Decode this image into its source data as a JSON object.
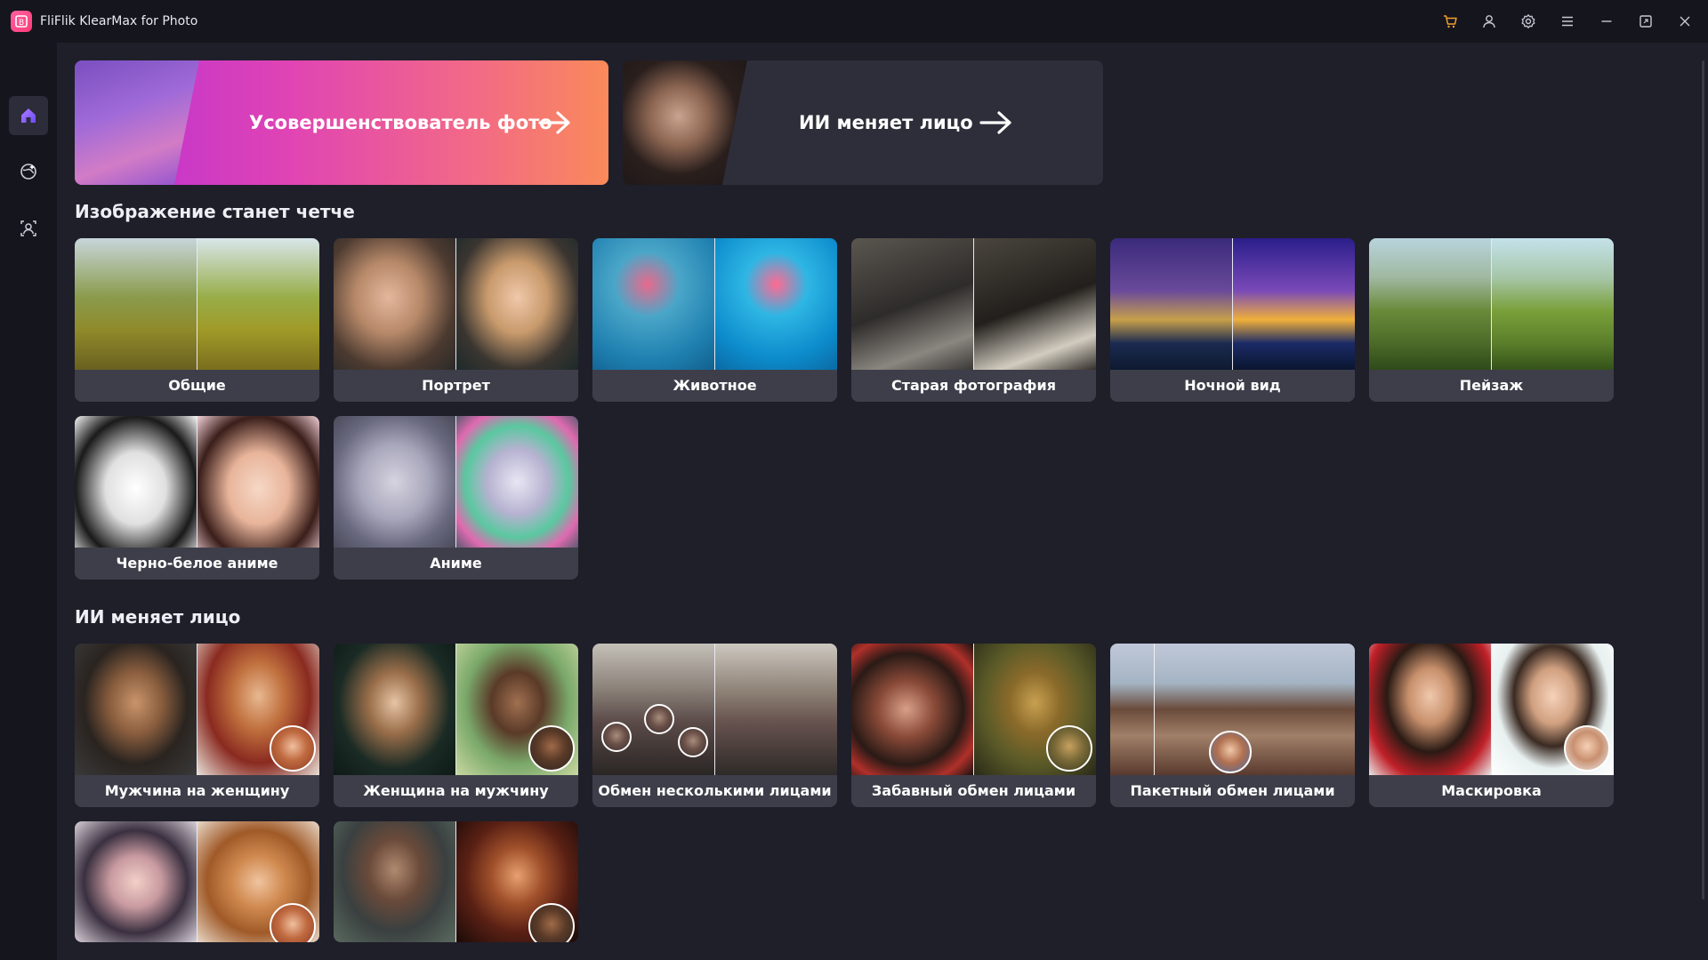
{
  "window": {
    "title": "FliFlik KlearMax for Photo",
    "logo_text": "B",
    "accent": "#ff4f8a",
    "cart_color": "#f0a030"
  },
  "titlebar_icons": [
    "cart-icon",
    "account-icon",
    "settings-icon",
    "menu-icon",
    "minimize-icon",
    "maximize-icon",
    "close-icon"
  ],
  "sidebar": {
    "items": [
      {
        "name": "home",
        "icon": "home-icon",
        "active": true
      },
      {
        "name": "enhancer",
        "icon": "globe-enhance-icon",
        "active": false
      },
      {
        "name": "face-swap",
        "icon": "face-swap-icon",
        "active": false
      }
    ]
  },
  "banners": {
    "enhancer": {
      "label": "Усовершенствователь фото"
    },
    "faceswap": {
      "label": "ИИ меняет лицо"
    }
  },
  "sections": {
    "enhance": {
      "title": "Изображение станет четче",
      "cards": [
        {
          "label": "Общие"
        },
        {
          "label": "Портрет"
        },
        {
          "label": "Животное"
        },
        {
          "label": "Старая фотография"
        },
        {
          "label": "Ночной вид"
        },
        {
          "label": "Пейзаж"
        },
        {
          "label": "Черно-белое аниме"
        },
        {
          "label": "Аниме"
        }
      ]
    },
    "faceswap": {
      "title": "ИИ меняет лицо",
      "cards": [
        {
          "label": "Мужчина на женщину"
        },
        {
          "label": "Женщина на мужчину"
        },
        {
          "label": "Обмен несколькими лицами"
        },
        {
          "label": "Забавный обмен лицами"
        },
        {
          "label": "Пакетный обмен лицами"
        },
        {
          "label": "Маскировка"
        }
      ]
    }
  }
}
